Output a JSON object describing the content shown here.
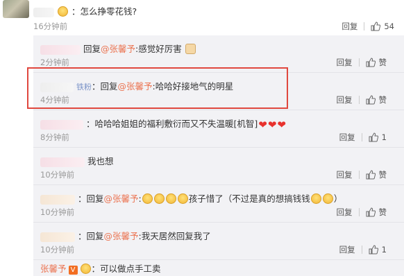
{
  "top_comment": {
    "text": "：怎么挣零花钱?",
    "time": "16分钟前",
    "reply_label": "回复",
    "likes": "54"
  },
  "replies": [
    {
      "time": "2分钟前",
      "reply_label": "回复",
      "like_label": "赞",
      "prefix": "回复",
      "mention": "@张馨予",
      "content": ":感觉好厉害"
    },
    {
      "time": "4分钟前",
      "reply_label": "回复",
      "like_label": "赞",
      "badge": "铁粉",
      "prefix": "：回复",
      "mention": "@张馨予",
      "content": ":哈哈好接地气的明星"
    },
    {
      "time": "8分钟前",
      "reply_label": "回复",
      "likes": "1",
      "content": "：哈哈哈姐姐的福利敷衍而又不失温暖[机智]"
    },
    {
      "time": "10分钟前",
      "reply_label": "回复",
      "like_label": "赞",
      "content": "我也想"
    },
    {
      "time": "10分钟前",
      "reply_label": "回复",
      "like_label": "赞",
      "prefix": "：回复",
      "mention": "@张馨予",
      "content": ":",
      "content2": "孩子惜了（不过是真的想搞钱钱",
      "content3": "）"
    },
    {
      "time": "10分钟前",
      "reply_label": "回复",
      "likes": "1",
      "prefix": "：回复",
      "mention": "@张馨予",
      "content": ":我天居然回复我了"
    }
  ],
  "last_comment": {
    "author": "张馨予",
    "vip": "V",
    "text": "：可以做点手工卖"
  },
  "colors": {
    "accent": "#eb7350",
    "highlight": "#e0473e",
    "panel": "#f2f2f5"
  }
}
